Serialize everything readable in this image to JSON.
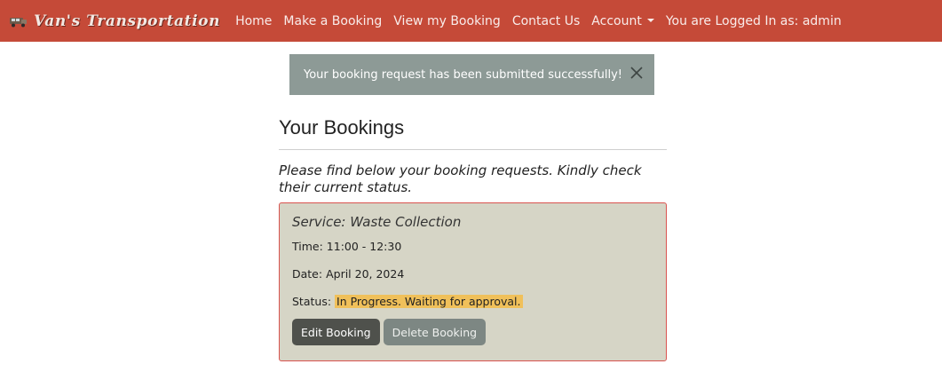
{
  "navbar": {
    "brand": "Van's Transportation",
    "brand_icon": "van-icon",
    "links": {
      "home": "Home",
      "make_booking": "Make a Booking",
      "view_booking": "View my Booking",
      "contact": "Contact Us",
      "account": "Account"
    },
    "logged_in": "You are Logged In as: admin",
    "accent_color": "#c54a38"
  },
  "alert": {
    "message": "Your booking request has been submitted successfully!",
    "close_icon": "close-icon"
  },
  "main": {
    "title": "Your Bookings",
    "intro": "Please find below your booking requests. Kindly check their current status."
  },
  "booking": {
    "service": "Service: Waste Collection",
    "time_label": "Time:",
    "time_value": "11:00 - 12:30",
    "date_label": "Date:",
    "date_value": "April 20, 2024",
    "status_label": "Status:",
    "status_value": "In Progress. Waiting for approval.",
    "edit_label": "Edit Booking",
    "delete_label": "Delete Booking"
  }
}
